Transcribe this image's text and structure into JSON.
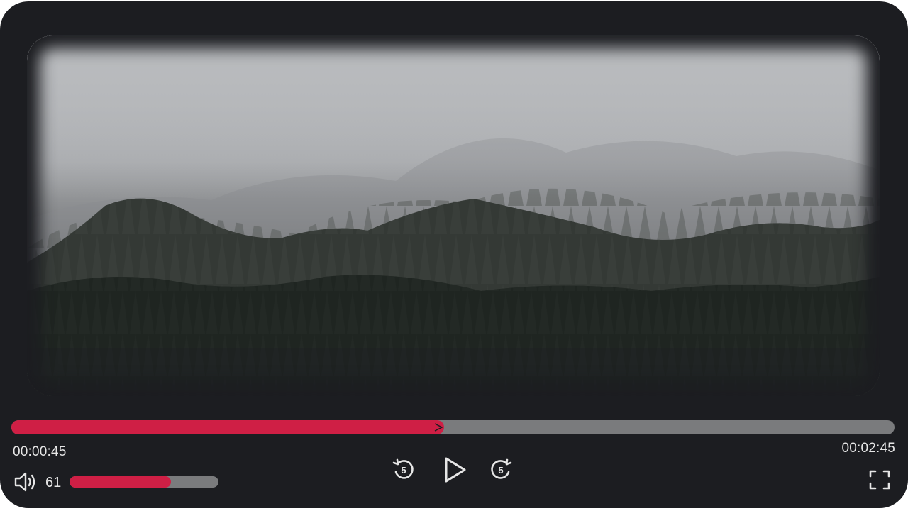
{
  "player": {
    "current_time": "00:00:45",
    "total_time": "00:02:45",
    "progress_fraction": 0.49,
    "volume": "61",
    "volume_fraction": 0.68,
    "colors": {
      "accent": "#cf1f45",
      "track": "#7a7b7d",
      "background": "#1c1d21",
      "text": "#e6e6e6"
    },
    "controls": {
      "volume_icon": "volume-icon",
      "rewind_icon": "rewind-5-icon",
      "rewind_label": "5",
      "play_icon": "play-icon",
      "forward_icon": "forward-5-icon",
      "forward_label": "5",
      "fullscreen_icon": "fullscreen-icon"
    }
  }
}
